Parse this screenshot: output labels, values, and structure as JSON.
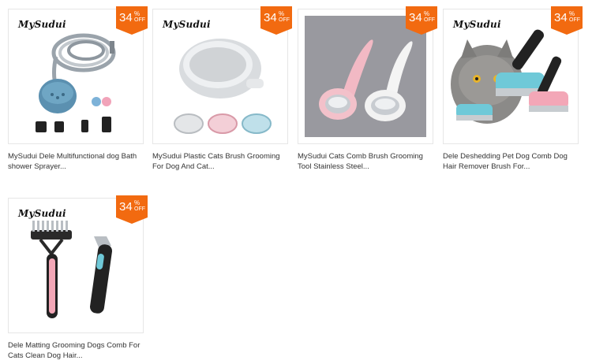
{
  "colors": {
    "badge": "#f26a10",
    "title_text": "#333333",
    "border": "#e6e6e6"
  },
  "products": [
    {
      "brand": "MySudui",
      "discount": "34",
      "discount_unit": "%",
      "discount_label": "OFF",
      "title_line1": "MySudui Dele Multifunctional dog Bath",
      "title_line2": "shower Sprayer..."
    },
    {
      "brand": "MySudui",
      "discount": "34",
      "discount_unit": "%",
      "discount_label": "OFF",
      "title_line1": "MySudui Plastic Cats Brush Grooming",
      "title_line2": "For Dog And Cat..."
    },
    {
      "discount": "34",
      "discount_unit": "%",
      "discount_label": "OFF",
      "title_line1": "MySudui Cats Comb Brush Grooming",
      "title_line2": "Tool Stainless Steel..."
    },
    {
      "brand": "MySudui",
      "discount": "34",
      "discount_unit": "%",
      "discount_label": "OFF",
      "title_line1": "Dele Deshedding Pet Dog Comb Dog",
      "title_line2": "Hair Remover Brush For..."
    },
    {
      "brand": "MySudui",
      "discount": "34",
      "discount_unit": "%",
      "discount_label": "OFF",
      "title_line1": "Dele Matting Grooming Dogs Comb For",
      "title_line2": "Cats Clean Dog Hair..."
    }
  ]
}
